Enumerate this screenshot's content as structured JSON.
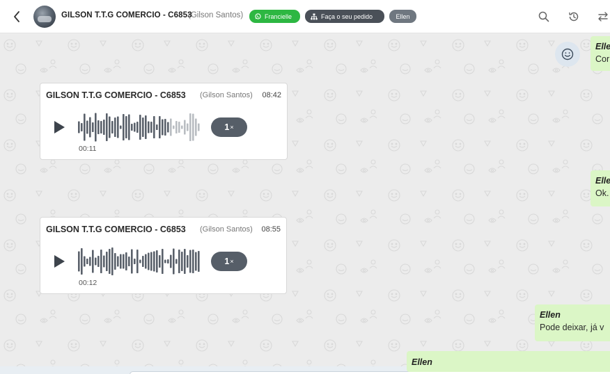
{
  "header": {
    "back_label": "Voltar",
    "contact_name": "GILSON T.T.G COMERCIO - C6853",
    "contact_sub": "(Gilson Santos)",
    "tags": [
      {
        "label": "Francielle",
        "icon": "whatsapp-icon",
        "color": "#2db742"
      },
      {
        "label": "Faça o seu pedido",
        "icon": "sitemap-icon",
        "color": "#4a5058"
      },
      {
        "label": "Ellen",
        "color": "#6f7780"
      }
    ],
    "actions": [
      "search-icon",
      "history-icon",
      "transfer-icon"
    ]
  },
  "messages": {
    "out_1": {
      "author": "Ellen",
      "text": "Cor"
    },
    "audio_1": {
      "sender": "GILSON T.T.G COMERCIO - C6853",
      "sender_sub": "(Gilson Santos)",
      "time": "08:42",
      "duration": "00:11",
      "speed": "1",
      "speed_suffix": "×",
      "progress": 0.73
    },
    "out_2": {
      "author": "Ellen",
      "text": "Ok."
    },
    "audio_2": {
      "sender": "GILSON T.T.G COMERCIO - C6853",
      "sender_sub": "(Gilson Santos)",
      "time": "08:55",
      "duration": "00:12",
      "speed": "1",
      "speed_suffix": "×",
      "progress": 0.0
    },
    "out_3": {
      "author": "Ellen",
      "text": "Pode deixar, já v"
    },
    "out_4": {
      "author": "Ellen",
      "text": ""
    }
  },
  "colors": {
    "accent_green": "#2db742",
    "bubble_out": "#dbf6c6",
    "speed_button": "#565e68"
  }
}
